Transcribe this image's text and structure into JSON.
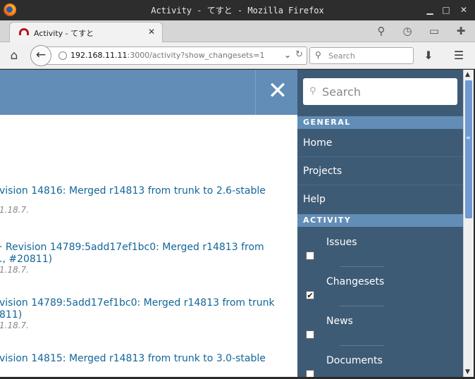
{
  "window": {
    "title": "Activity - てすと - Mozilla Firefox",
    "minimize": "▁",
    "maximize": "□",
    "close": "✕"
  },
  "tab": {
    "title": "Activity - てすと",
    "close": "✕"
  },
  "tabbar_icons": {
    "zoom": "⚲",
    "history": "◷",
    "sidebar": "▭",
    "addons": "✚"
  },
  "navbar": {
    "home": "⌂",
    "back": "←",
    "url_host": "192.168.11.11",
    "url_rest": ":3000/activity?show_changesets=1",
    "dropdown": "⌄",
    "reload": "↻",
    "search_placeholder": "Search",
    "download": "⬇",
    "menu": "☰"
  },
  "header": {
    "close_symbol": "✕"
  },
  "entries": [
    {
      "title": "vision 14816: Merged r14813 from trunk to 2.6-stable",
      "title_line2": "",
      "meta": "1.18.7."
    },
    {
      "title": "· Revision 14789:5add17ef1bc0: Merged r14813 from",
      "title_line2": "., #20811)",
      "meta": "1.18.7."
    },
    {
      "title": "vision 14789:5add17ef1bc0: Merged r14813 from trunk",
      "title_line2": "811)",
      "meta": "1.18.7."
    },
    {
      "title": "vision 14815: Merged r14813 from trunk to 3.0-stable",
      "title_line2": "",
      "meta": ""
    }
  ],
  "sidebar": {
    "search_placeholder": "Search",
    "general_heading": "GENERAL",
    "links": [
      "Home",
      "Projects",
      "Help"
    ],
    "activity_heading": "ACTIVITY",
    "checks": [
      {
        "label": "Issues",
        "checked": false
      },
      {
        "label": "Changesets",
        "checked": true
      },
      {
        "label": "News",
        "checked": false
      },
      {
        "label": "Documents",
        "checked": false
      }
    ]
  },
  "scrollbar": {
    "up": "▲",
    "down": "▼",
    "grip": "≡"
  },
  "colors": {
    "header_blue": "#628db6",
    "sidebar_bg": "#3e5b76",
    "link": "#116699"
  }
}
